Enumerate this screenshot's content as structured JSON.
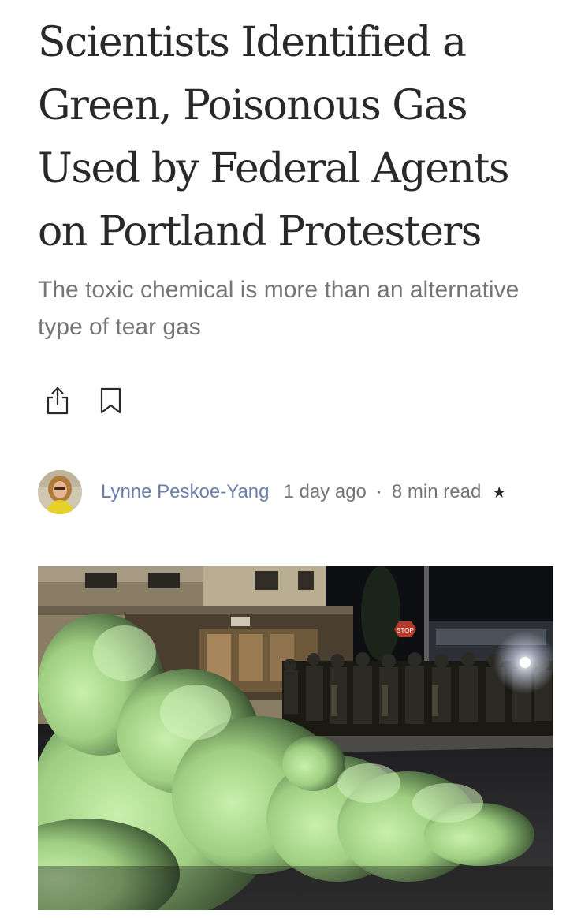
{
  "article": {
    "title": "Scientists Identified a Green, Poisonous Gas Used by Federal Agents on Portland Protesters",
    "subtitle": "The toxic chemical is more than an alternative type of tear gas"
  },
  "actions": {
    "share_icon": "share-icon",
    "bookmark_icon": "bookmark-icon"
  },
  "byline": {
    "author": "Lynne Peskoe-Yang",
    "published": "1 day ago",
    "separator": "·",
    "read_time": "8 min read",
    "member_star": "★"
  },
  "hero_image": {
    "sign_text": "STOP"
  },
  "colors": {
    "title": "#292929",
    "subtitle": "#757575",
    "author_link": "#6b80ad",
    "smoke": "#b7e39a"
  }
}
